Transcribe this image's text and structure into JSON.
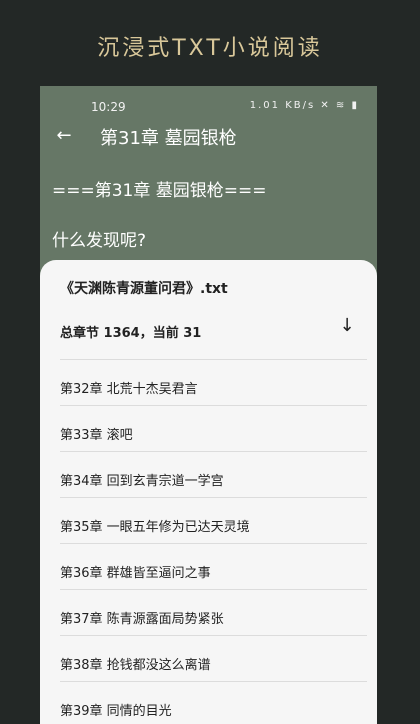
{
  "promo_title": "沉浸式TXT小说阅读",
  "status_bar": {
    "time": "10:29",
    "icons": "1.01 KB/s ✕ ≋ ▮"
  },
  "app_bar": {
    "back_icon": "←",
    "title": "第31章 墓园银枪"
  },
  "reader": {
    "line1": "===第31章 墓园银枪===",
    "line2": "什么发现呢?"
  },
  "sheet": {
    "book_name": "《天渊陈青源董问君》.txt",
    "chapter_count": "总章节 1364，当前 31",
    "scroll_icon": "↓",
    "chapters": [
      "第32章 北荒十杰吴君言",
      "第33章 滚吧",
      "第34章 回到玄青宗道一学宫",
      "第35章 一眼五年修为已达天灵境",
      "第36章 群雄皆至逼问之事",
      "第37章 陈青源露面局势紧张",
      "第38章 抢钱都没这么离谱",
      "第39章 同情的目光"
    ]
  }
}
